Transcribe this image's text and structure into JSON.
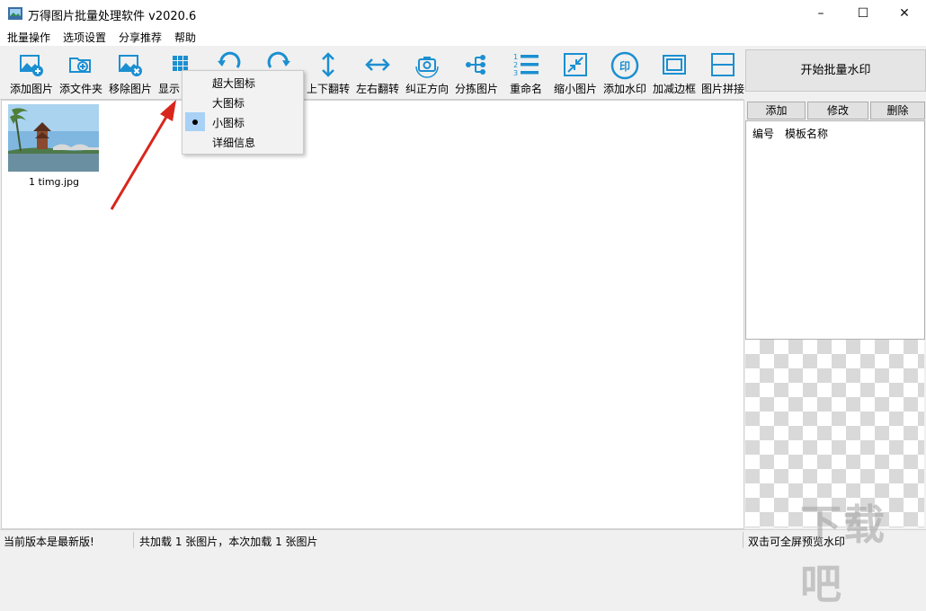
{
  "window": {
    "title": "万得图片批量处理软件 v2020.6",
    "minimize": "–",
    "maximize": "☐",
    "close": "✕"
  },
  "menu": [
    "批量操作",
    "选项设置",
    "分享推荐",
    "帮助"
  ],
  "toolbar": [
    {
      "label": "添加图片",
      "icon": "add-image-icon"
    },
    {
      "label": "添文件夹",
      "icon": "add-folder-icon"
    },
    {
      "label": "移除图片",
      "icon": "remove-image-icon"
    },
    {
      "label": "显示",
      "icon": "grid-view-icon"
    },
    {
      "label": "",
      "icon": "rotate-left-icon"
    },
    {
      "label": "",
      "icon": "rotate-right-icon"
    },
    {
      "label": "上下翻转",
      "icon": "flip-vertical-icon"
    },
    {
      "label": "左右翻转",
      "icon": "flip-horizontal-icon"
    },
    {
      "label": "纠正方向",
      "icon": "camera-rotate-icon"
    },
    {
      "label": "分拣图片",
      "icon": "sort-icon"
    },
    {
      "label": "重命名",
      "icon": "list-numbered-icon"
    },
    {
      "label": "缩小图片",
      "icon": "shrink-icon"
    },
    {
      "label": "添加水印",
      "icon": "watermark-stamp-icon"
    },
    {
      "label": "加减边框",
      "icon": "border-icon"
    },
    {
      "label": "图片拼接",
      "icon": "join-icon"
    }
  ],
  "display_menu": {
    "items": [
      "超大图标",
      "大图标",
      "小图标",
      "详细信息"
    ],
    "selected_index": 2
  },
  "images": [
    {
      "caption": "1 timg.jpg"
    }
  ],
  "side": {
    "start_button": "开始批量水印",
    "add": "添加",
    "edit": "修改",
    "delete": "删除",
    "col_id": "编号",
    "col_name": "模板名称"
  },
  "status": {
    "version": "当前版本是最新版!",
    "loaded": "共加载 1 张图片，本次加载 1 张图片",
    "hint": "双击可全屏预览水印"
  },
  "watermark_logo": "下载吧",
  "colors": {
    "accent": "#1b8fd1",
    "arrow": "#d9261c",
    "selection": "#a8d1f5"
  }
}
